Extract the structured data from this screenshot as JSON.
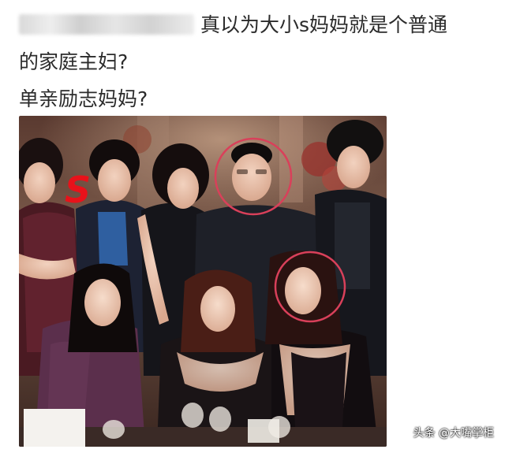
{
  "post": {
    "caption_line_1": "真以为大小s妈妈就是个普通",
    "caption_line_2": "的家庭主妇?",
    "caption_line_3": "单亲励志妈妈?"
  },
  "photo": {
    "annotation_mark": "S",
    "highlight_color": "#d9405a",
    "mark_color": "#e8121a"
  },
  "watermark": {
    "text": "头条 @大嘴掌柜"
  }
}
